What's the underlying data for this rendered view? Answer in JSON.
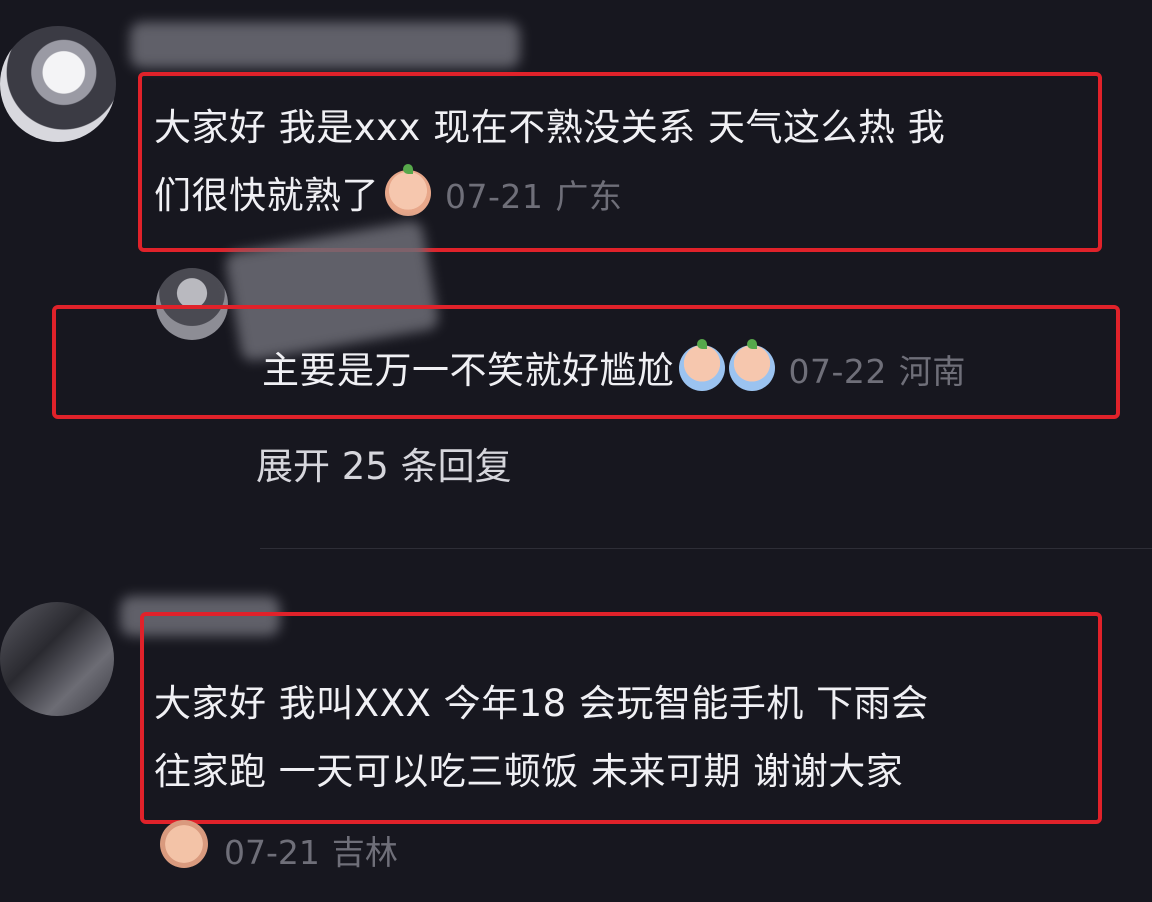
{
  "comments": [
    {
      "text_line1": "大家好 我是xxx 现在不熟没关系 天气这么热 我",
      "text_line2": "们很快就熟了",
      "date": "07-21",
      "region": "广东"
    },
    {
      "text": "主要是万一不笑就好尴尬",
      "date": "07-22",
      "region": "河南",
      "expand_label": "展开 25 条回复"
    },
    {
      "text_line1": "大家好 我叫XXX 今年18 会玩智能手机 下雨会",
      "text_line2": "往家跑 一天可以吃三顿饭 未来可期 谢谢大家",
      "date": "07-21",
      "region": "吉林"
    }
  ],
  "colors": {
    "background": "#17171f",
    "highlight_border": "#e0222a",
    "meta_text": "#6f6f79"
  }
}
